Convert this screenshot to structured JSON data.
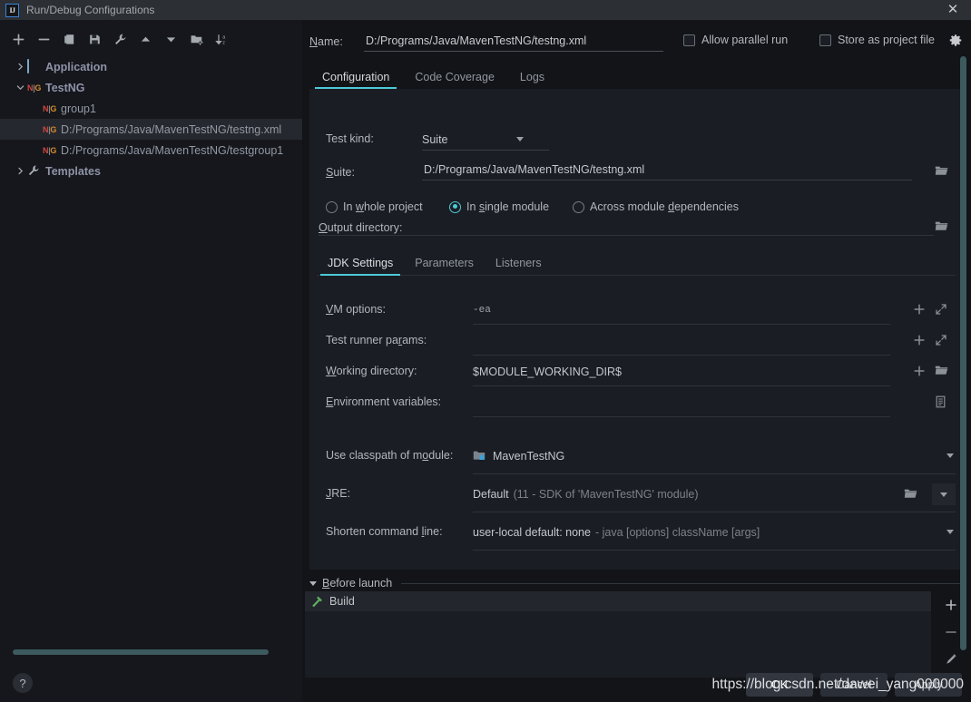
{
  "window": {
    "title": "Run/Debug Configurations",
    "logo_icon": "intellij-idea-logo",
    "close_icon": "close-icon",
    "close_glyph": "✕"
  },
  "tree_toolbar": {
    "items": [
      {
        "name": "add-configuration-button",
        "icon": "plus-icon"
      },
      {
        "name": "remove-configuration-button",
        "icon": "minus-icon"
      },
      {
        "name": "copy-configuration-button",
        "icon": "copy-icon"
      },
      {
        "name": "save-configuration-button",
        "icon": "save-icon"
      },
      {
        "name": "edit-templates-button",
        "icon": "wrench-icon"
      },
      {
        "name": "move-up-button",
        "icon": "arrow-up-icon"
      },
      {
        "name": "move-down-button",
        "icon": "arrow-down-icon"
      },
      {
        "name": "new-folder-button",
        "icon": "folder-add-icon"
      },
      {
        "name": "sort-alphabetically-button",
        "icon": "sort-az-icon"
      }
    ]
  },
  "tree": {
    "nodes": [
      {
        "label": "Application",
        "icon": "application-icon",
        "type": "group",
        "expanded": false,
        "selected": false,
        "chevron": "chevron-right-icon"
      },
      {
        "label": "TestNG",
        "icon": "testng-icon",
        "type": "group",
        "expanded": true,
        "selected": false,
        "chevron": "chevron-down-icon"
      },
      {
        "label": "group1",
        "icon": "testng-icon",
        "type": "child",
        "selected": false
      },
      {
        "label": "D:/Programs/Java/MavenTestNG/testng.xml",
        "icon": "testng-icon",
        "type": "child",
        "selected": true
      },
      {
        "label": "D:/Programs/Java/MavenTestNG/testgroup1",
        "icon": "testng-icon",
        "type": "child",
        "selected": false
      },
      {
        "label": "Templates",
        "icon": "wrench-icon",
        "type": "group",
        "expanded": false,
        "selected": false,
        "chevron": "chevron-right-icon"
      }
    ],
    "horizontal_scrollbar": "tree-horizontal-scrollbar",
    "help_button_glyph": "?"
  },
  "header": {
    "name_label": "Name:",
    "name_label_mnemonic": "N",
    "name_value": "D:/Programs/Java/MavenTestNG/testng.xml",
    "allow_parallel_run_label": "Allow parallel run",
    "allow_parallel_run_checked": false,
    "store_as_project_file_label": "Store as project file",
    "store_as_project_file_checked": false,
    "gear_icon": "gear-icon"
  },
  "top_tabs": [
    {
      "label": "Configuration",
      "active": true
    },
    {
      "label": "Code Coverage",
      "active": false
    },
    {
      "label": "Logs",
      "active": false
    }
  ],
  "configuration": {
    "test_kind_label": "Test kind:",
    "test_kind_value": "Suite",
    "test_kind_options": [
      "Suite"
    ],
    "suite_label": "Suite:",
    "suite_label_mnemonic": "S",
    "suite_value": "D:/Programs/Java/MavenTestNG/testng.xml",
    "suite_browse_icon": "folder-open-icon",
    "scope_radios": [
      {
        "label": "In whole project",
        "mnemonic": "w",
        "checked": false
      },
      {
        "label": "In single module",
        "mnemonic": "s",
        "checked": true
      },
      {
        "label": "Across module dependencies",
        "mnemonic": "d",
        "checked": false
      }
    ],
    "output_directory_label": "Output directory:",
    "output_directory_value": "",
    "output_directory_browse_icon": "folder-open-icon"
  },
  "inner_tabs": [
    {
      "label": "JDK Settings",
      "active": true
    },
    {
      "label": "Parameters",
      "active": false
    },
    {
      "label": "Listeners",
      "active": false
    }
  ],
  "jdk_settings": {
    "rows": [
      {
        "label": "VM options:",
        "mnemonic": "V",
        "value": "-ea",
        "mono": true,
        "icons": [
          "plus-icon",
          "expand-icon"
        ]
      },
      {
        "label": "Test runner params:",
        "mnemonic": "r",
        "value": "",
        "mono": false,
        "icons": [
          "plus-icon",
          "expand-icon"
        ]
      },
      {
        "label": "Working directory:",
        "mnemonic": "W",
        "value": "$MODULE_WORKING_DIR$",
        "mono": false,
        "icons": [
          "plus-icon",
          "folder-open-icon"
        ]
      },
      {
        "label": "Environment variables:",
        "mnemonic": "E",
        "value": "",
        "mono": false,
        "icons": [
          "list-edit-icon"
        ]
      }
    ],
    "classpath_label": "Use classpath of module:",
    "classpath_mnemonic": "o",
    "classpath_value": "MavenTestNG",
    "classpath_icon": "module-icon",
    "classpath_arrow": "chevron-down-icon",
    "jre_label": "JRE:",
    "jre_mnemonic": "J",
    "jre_value": "Default",
    "jre_value_muted": "(11 - SDK of 'MavenTestNG' module)",
    "jre_browse_icon": "folder-open-icon",
    "jre_arrow": "chevron-down-icon",
    "shorten_label": "Shorten command line:",
    "shorten_mnemonic": "l",
    "shorten_value": "user-local default: none",
    "shorten_value_muted": "- java [options] className [args]",
    "shorten_arrow": "chevron-down-icon"
  },
  "before_launch": {
    "header_label": "Before launch",
    "header_mnemonic": "B",
    "expanded": true,
    "items": [
      {
        "label": "Build",
        "icon": "build-hammer-icon"
      }
    ],
    "actions": [
      {
        "name": "add-before-launch-task-button",
        "icon": "plus-icon"
      },
      {
        "name": "remove-before-launch-task-button",
        "icon": "minus-icon"
      },
      {
        "name": "edit-before-launch-task-button",
        "icon": "pencil-icon"
      },
      {
        "name": "move-before-launch-task-up-button",
        "icon": "arrow-up-icon"
      }
    ]
  },
  "dialog_buttons": [
    {
      "label": "OK",
      "primary": true
    },
    {
      "label": "Cancel",
      "primary": false
    },
    {
      "label": "Apply",
      "primary": false
    }
  ],
  "watermark": "https://blog.csdn.net/dawei_yang000000",
  "colors": {
    "accent": "#4ec9d6",
    "scrollbar": "#3d5a5e",
    "panel_bg": "#1a1d23",
    "window_bg": "#121418",
    "titlebar_bg": "#2c2f34",
    "sidebar_bg": "#15171c",
    "selected_row": "#25282e",
    "text": "#b3b6bb",
    "testng_n": "#cc4a40",
    "testng_g": "#d68b2a"
  }
}
